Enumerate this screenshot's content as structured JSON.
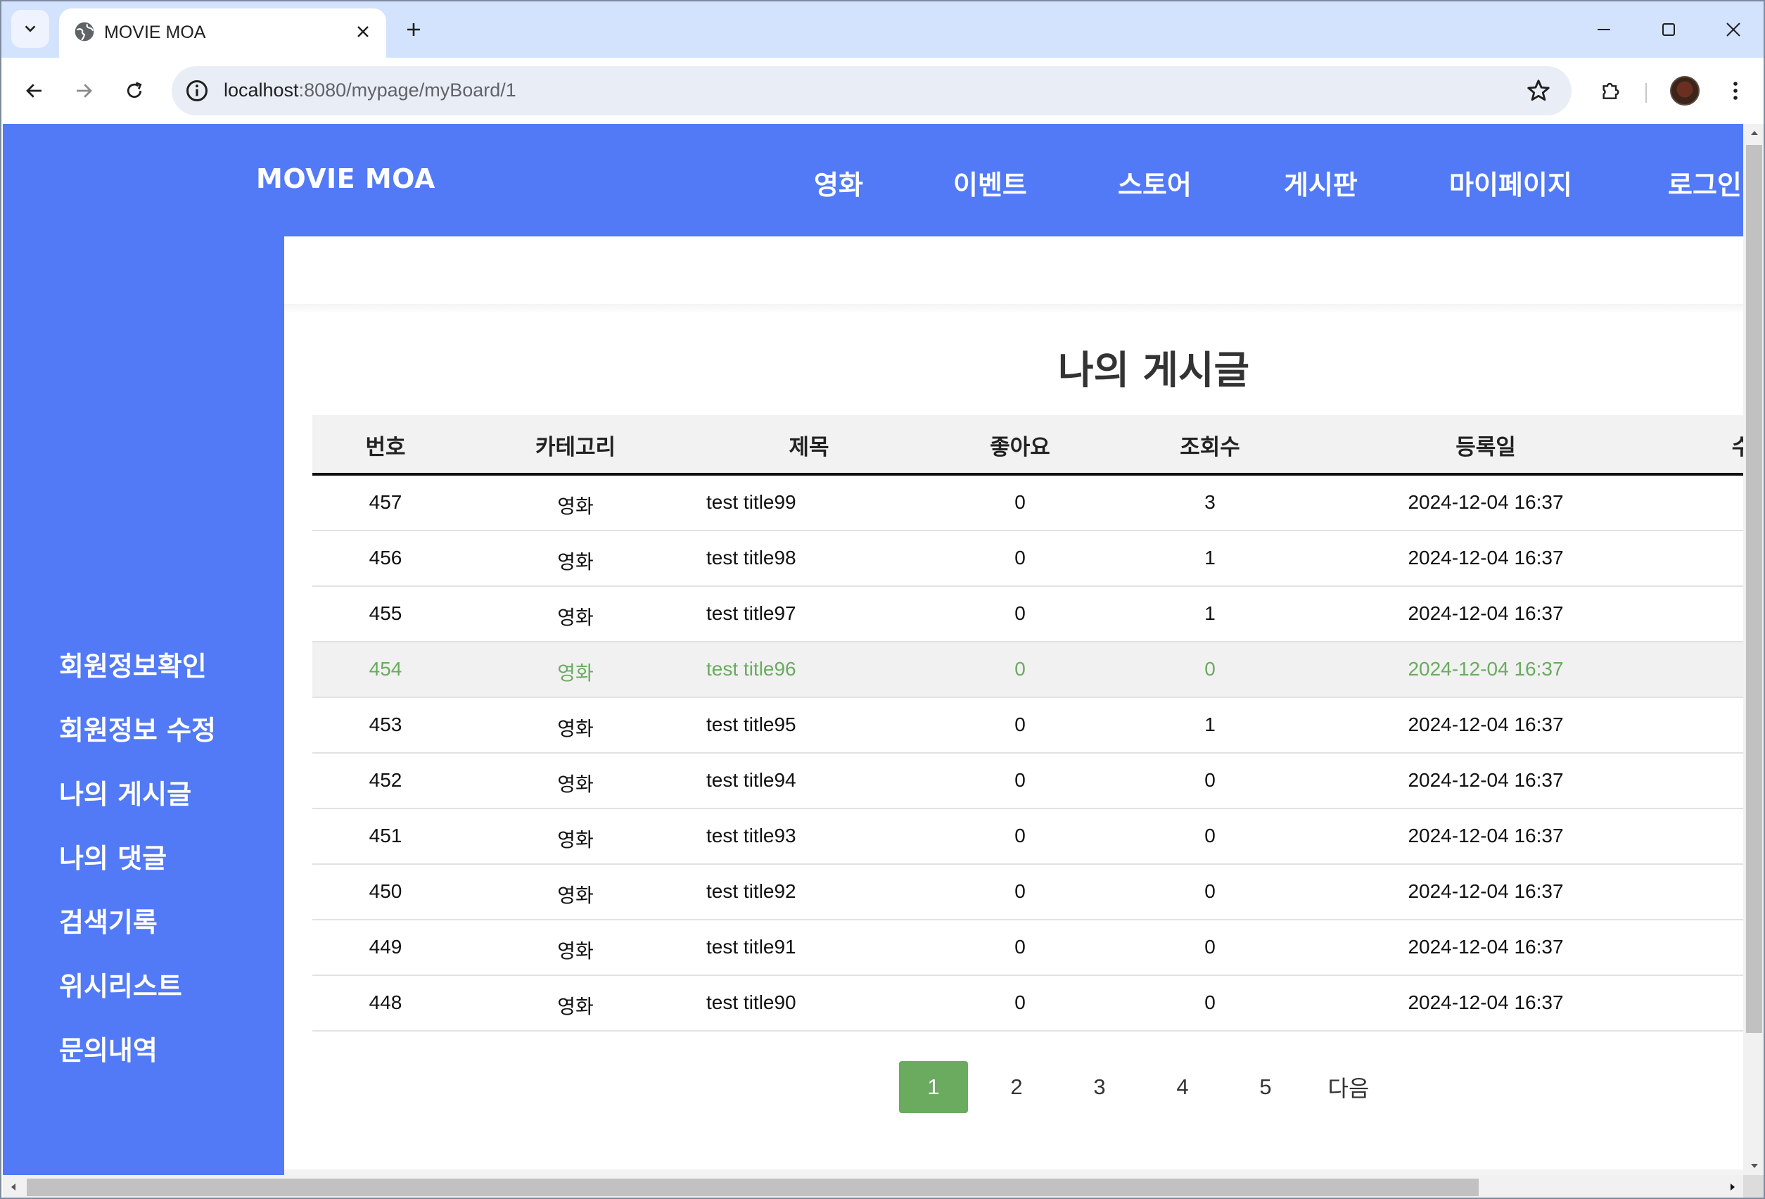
{
  "browser": {
    "tab_title": "MOVIE MOA",
    "url_host": "localhost",
    "url_path": ":8080/mypage/myBoard/1"
  },
  "header": {
    "logo": "MOVIE MOA",
    "nav": [
      "영화",
      "이벤트",
      "스토어",
      "게시판",
      "마이페이지",
      "로그인"
    ]
  },
  "sidebar": {
    "items": [
      "회원정보확인",
      "회원정보 수정",
      "나의 게시글",
      "나의 댓글",
      "검색기록",
      "위시리스트",
      "문의내역"
    ]
  },
  "page": {
    "title": "나의 게시글"
  },
  "table": {
    "headers": [
      "번호",
      "카테고리",
      "제목",
      "좋아요",
      "조회수",
      "등록일",
      "수"
    ],
    "rows": [
      {
        "no": "457",
        "category": "영화",
        "title": "test title99",
        "likes": "0",
        "views": "3",
        "date": "2024-12-04 16:37"
      },
      {
        "no": "456",
        "category": "영화",
        "title": "test title98",
        "likes": "0",
        "views": "1",
        "date": "2024-12-04 16:37"
      },
      {
        "no": "455",
        "category": "영화",
        "title": "test title97",
        "likes": "0",
        "views": "1",
        "date": "2024-12-04 16:37"
      },
      {
        "no": "454",
        "category": "영화",
        "title": "test title96",
        "likes": "0",
        "views": "0",
        "date": "2024-12-04 16:37"
      },
      {
        "no": "453",
        "category": "영화",
        "title": "test title95",
        "likes": "0",
        "views": "1",
        "date": "2024-12-04 16:37"
      },
      {
        "no": "452",
        "category": "영화",
        "title": "test title94",
        "likes": "0",
        "views": "0",
        "date": "2024-12-04 16:37"
      },
      {
        "no": "451",
        "category": "영화",
        "title": "test title93",
        "likes": "0",
        "views": "0",
        "date": "2024-12-04 16:37"
      },
      {
        "no": "450",
        "category": "영화",
        "title": "test title92",
        "likes": "0",
        "views": "0",
        "date": "2024-12-04 16:37"
      },
      {
        "no": "449",
        "category": "영화",
        "title": "test title91",
        "likes": "0",
        "views": "0",
        "date": "2024-12-04 16:37"
      },
      {
        "no": "448",
        "category": "영화",
        "title": "test title90",
        "likes": "0",
        "views": "0",
        "date": "2024-12-04 16:37"
      }
    ],
    "hovered_row_index": 3
  },
  "pagination": {
    "pages": [
      "1",
      "2",
      "3",
      "4",
      "5"
    ],
    "current": "1",
    "next_label": "다음"
  },
  "colors": {
    "brand_blue": "#527af6",
    "accent_green": "#6aab5f"
  },
  "icons": {
    "tab_search": "chevron-down-icon",
    "favicon": "globe-icon",
    "tab_close": "close-icon",
    "new_tab": "plus-icon",
    "back": "arrow-left-icon",
    "forward": "arrow-right-icon",
    "reload": "reload-icon",
    "site_info": "info-icon",
    "bookmark": "star-icon",
    "extensions": "puzzle-icon",
    "menu": "kebab-menu-icon"
  }
}
